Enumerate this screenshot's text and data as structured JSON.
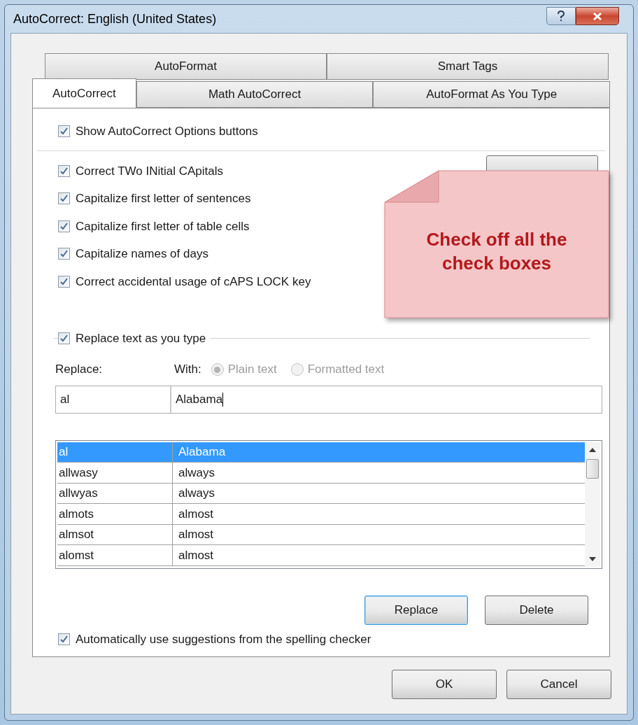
{
  "window": {
    "title": "AutoCorrect: English (United States)"
  },
  "tab_rows": [
    [
      {
        "label": "AutoFormat",
        "selected": false
      },
      {
        "label": "Smart Tags",
        "selected": false
      }
    ],
    [
      {
        "label": "AutoCorrect",
        "selected": true
      },
      {
        "label": "Math AutoCorrect",
        "selected": false
      },
      {
        "label": "AutoFormat As You Type",
        "selected": false
      }
    ]
  ],
  "show_options": {
    "label": "Show AutoCorrect Options buttons",
    "checked": true
  },
  "options": [
    {
      "label": "Correct TWo INitial CApitals",
      "checked": true
    },
    {
      "label": "Capitalize first letter of sentences",
      "checked": true
    },
    {
      "label": "Capitalize first letter of table cells",
      "checked": true
    },
    {
      "label": "Capitalize names of days",
      "checked": true
    },
    {
      "label": "Correct accidental usage of cAPS LOCK key",
      "checked": true
    }
  ],
  "replace_text": {
    "label": "Replace text as you type",
    "checked": true
  },
  "replace_label": "Replace:",
  "with_label": "With:",
  "format_radios": [
    {
      "label": "Plain text",
      "selected": true,
      "disabled": true
    },
    {
      "label": "Formatted text",
      "selected": false,
      "disabled": true
    }
  ],
  "replace_value": "al",
  "with_value": "Alabama",
  "entries": [
    {
      "from": "al",
      "to": "Alabama",
      "selected": true
    },
    {
      "from": "allwasy",
      "to": "always",
      "selected": false
    },
    {
      "from": "allwyas",
      "to": "always",
      "selected": false
    },
    {
      "from": "almots",
      "to": "almost",
      "selected": false
    },
    {
      "from": "almsot",
      "to": "almost",
      "selected": false
    },
    {
      "from": "alomst",
      "to": "almost",
      "selected": false
    }
  ],
  "list_buttons": [
    {
      "label": "Replace",
      "focused": true
    },
    {
      "label": "Delete",
      "focused": false
    }
  ],
  "spelling": {
    "label": "Automatically use suggestions from the spelling checker",
    "checked": true
  },
  "dialog_buttons": [
    {
      "label": "OK"
    },
    {
      "label": "Cancel"
    }
  ],
  "callout": {
    "text": "Check off all the check boxes"
  }
}
